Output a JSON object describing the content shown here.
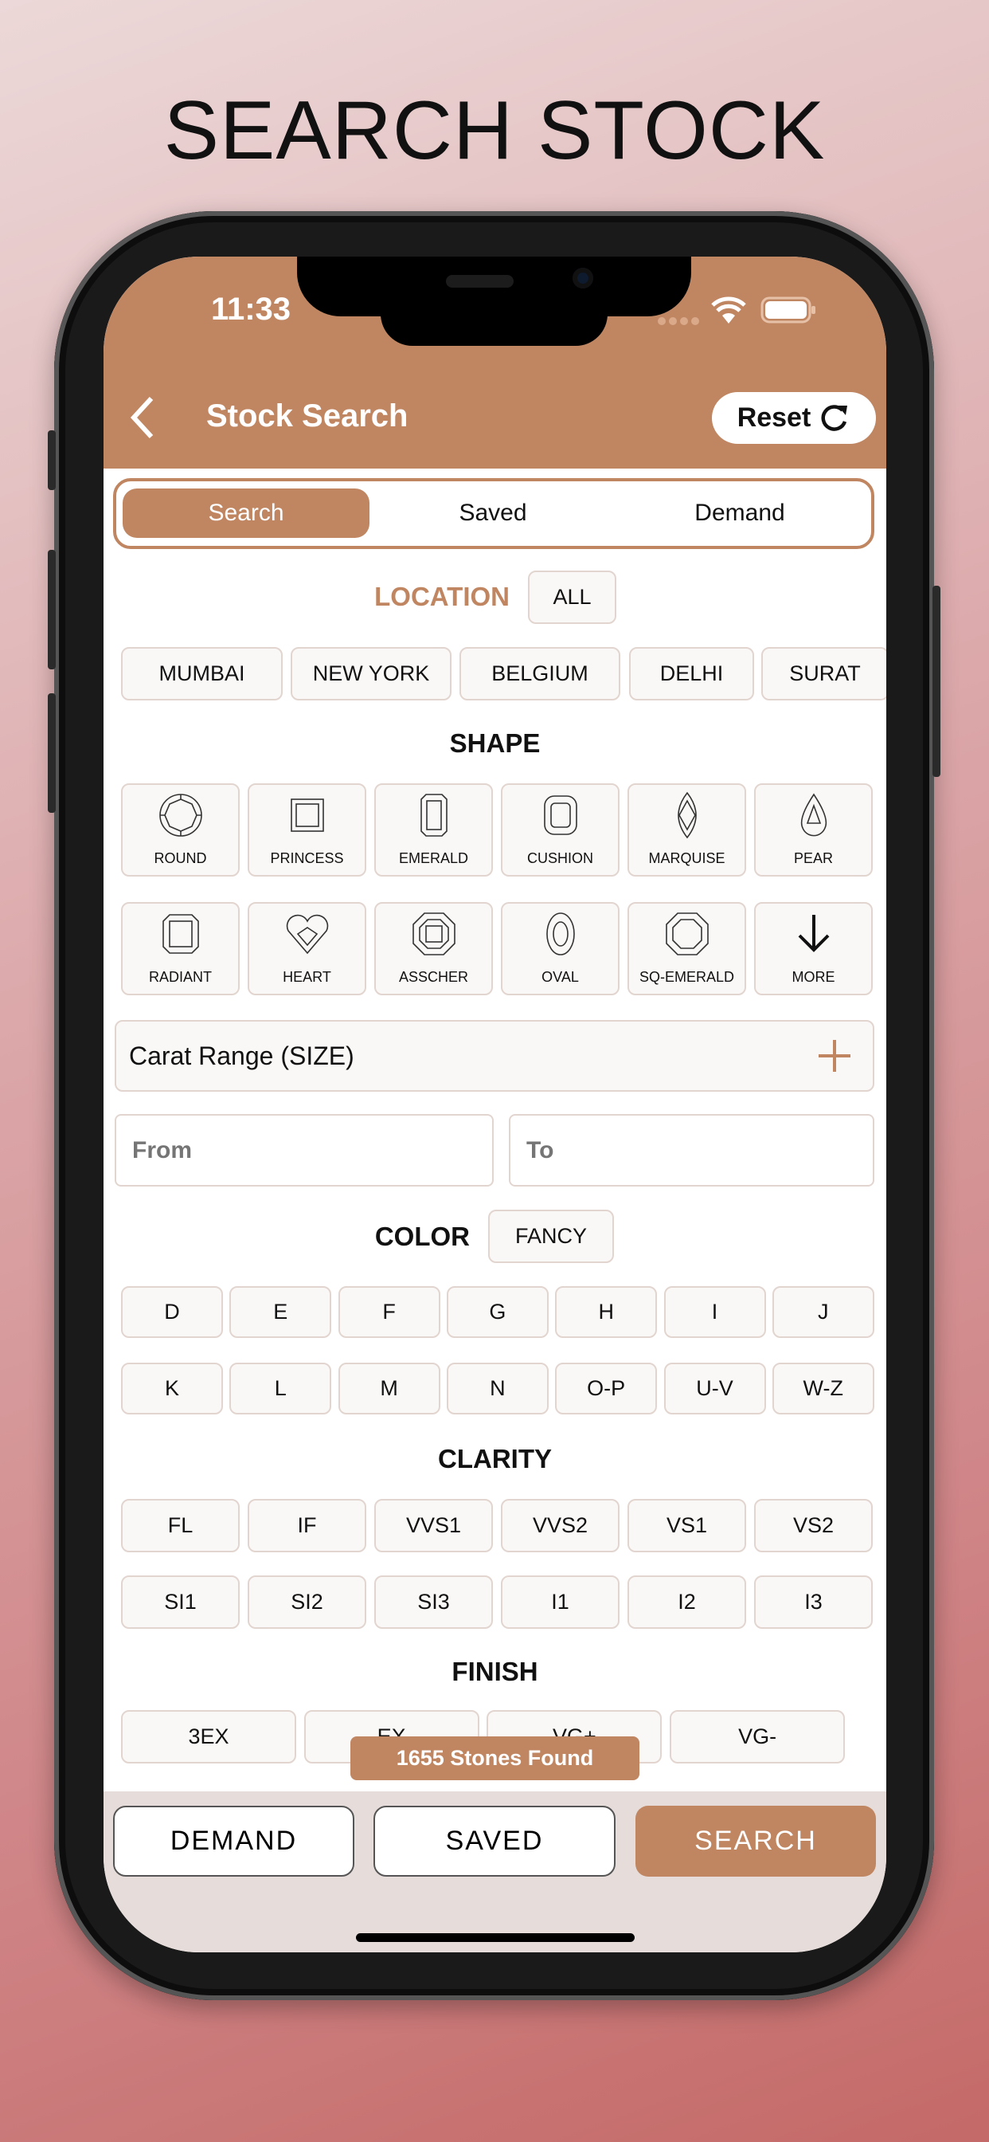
{
  "page_title": "SEARCH STOCK",
  "status_bar": {
    "time": "11:33"
  },
  "header": {
    "title": "Stock Search",
    "reset_label": "Reset"
  },
  "tabs": [
    {
      "label": "Search",
      "active": true
    },
    {
      "label": "Saved"
    },
    {
      "label": "Demand"
    }
  ],
  "location": {
    "label": "LOCATION",
    "all_label": "ALL",
    "items": [
      "MUMBAI",
      "NEW YORK",
      "BELGIUM",
      "DELHI",
      "SURAT"
    ]
  },
  "shape": {
    "label": "SHAPE",
    "items": [
      "ROUND",
      "PRINCESS",
      "EMERALD",
      "CUSHION",
      "MARQUISE",
      "PEAR",
      "RADIANT",
      "HEART",
      "ASSCHER",
      "OVAL",
      "SQ-EMERALD",
      "MORE"
    ]
  },
  "carat": {
    "label": "Carat Range (SIZE)",
    "from_placeholder": "From",
    "to_placeholder": "To"
  },
  "color": {
    "label": "COLOR",
    "fancy_label": "FANCY",
    "items": [
      "D",
      "E",
      "F",
      "G",
      "H",
      "I",
      "J",
      "K",
      "L",
      "M",
      "N",
      "O-P",
      "U-V",
      "W-Z"
    ]
  },
  "clarity": {
    "label": "CLARITY",
    "items": [
      "FL",
      "IF",
      "VVS1",
      "VVS2",
      "VS1",
      "VS2",
      "SI1",
      "SI2",
      "SI3",
      "I1",
      "I2",
      "I3"
    ]
  },
  "finish": {
    "label": "FINISH",
    "items": [
      "3EX",
      "EX",
      "VG+",
      "VG-"
    ]
  },
  "toast": "1655 Stones Found",
  "bottom": {
    "demand": "DEMAND",
    "saved": "SAVED",
    "search": "SEARCH"
  },
  "colors": {
    "brand": "#c08662",
    "bottom_bar": "#e6dcd9",
    "chip_border": "#e2d5cf"
  }
}
